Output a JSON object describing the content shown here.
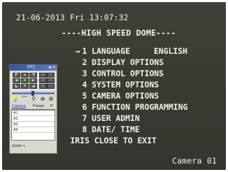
{
  "osd": {
    "datetime": "21-06-2013 Fri 13:07:32",
    "title": "----HIGH SPEED DOME----",
    "selected_arrow": "→",
    "menu_items": [
      {
        "label": "1 LANGUAGE",
        "value": "ENGLISH"
      },
      {
        "label": "2 DISPLAY OPTIONS"
      },
      {
        "label": "3 CONTROL OPTIONS"
      },
      {
        "label": "4 SYSTEM OPTIONS"
      },
      {
        "label": "5 CAMERA OPTIONS"
      },
      {
        "label": "6 FUNCTION PROGRAMMING"
      },
      {
        "label": "7 USER ADMIN"
      },
      {
        "label": "8 DATE/ TIME"
      },
      {
        "label": "IRIS CLOSE TO EXIT"
      }
    ],
    "camera_label": "Camera 01"
  },
  "ptz": {
    "title": "PTZ",
    "close_label": "◄ ×",
    "tabs": [
      "Camera",
      "Preset",
      "P"
    ],
    "presets": [
      "A1",
      "A2",
      "A3",
      "A4"
    ],
    "zoom_label": "Zoom +"
  }
}
